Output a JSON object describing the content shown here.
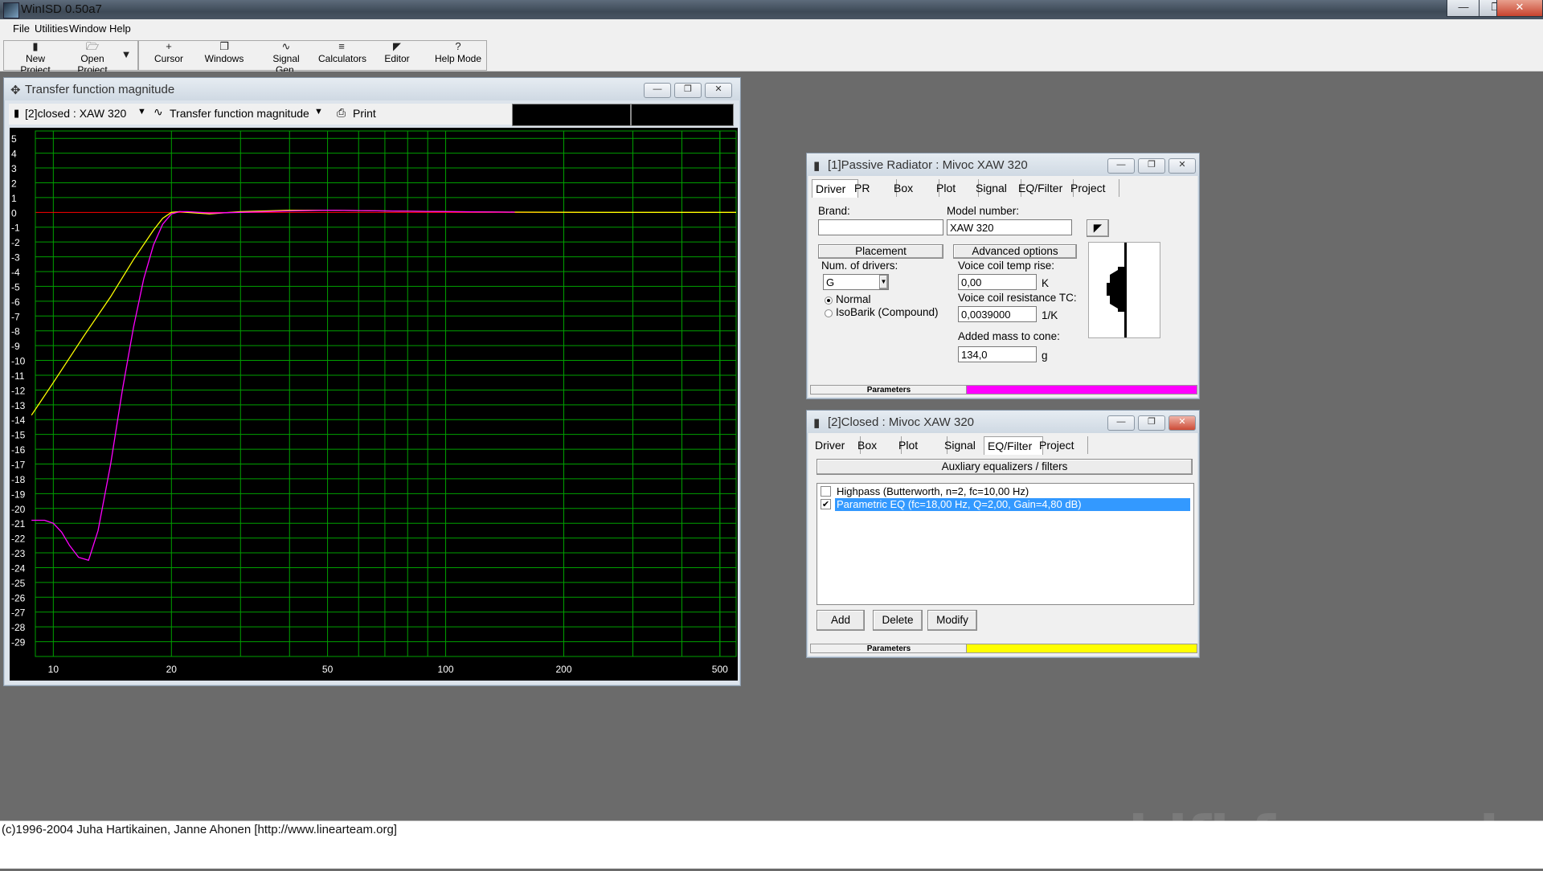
{
  "app": {
    "title": "WinISD 0.50a7",
    "colors": {
      "chart_bg": "#000000",
      "grid": "#00a000",
      "zero_line": "#ff0000",
      "pr_series": "#ffff00",
      "closed_series": "#ff00ff"
    }
  },
  "menu": {
    "file": "File",
    "utilities": "Utilities",
    "window": "Window",
    "help": "Help"
  },
  "toolbar": {
    "new_project": "New Project",
    "open_project": "Open Project",
    "cursor": "Cursor",
    "windows": "Windows",
    "signal_gen": "Signal Gen.",
    "calculators": "Calculators",
    "editor": "Editor",
    "help_mode": "Help Mode",
    "icons": {
      "new_project": "document-icon",
      "open_project": "folder-icon",
      "cursor": "crosshair-icon",
      "windows": "windows-icon",
      "signal_gen": "waveform-icon",
      "calculators": "calculator-icon",
      "editor": "speaker-icon",
      "help_mode": "question-icon"
    }
  },
  "chart_window": {
    "title": "Transfer function magnitude",
    "project_select": "[2]closed : XAW 320",
    "plot_select": "Transfer function magnitude",
    "print_label": "Print"
  },
  "chart_data": {
    "type": "line",
    "title": "",
    "xlabel": "",
    "ylabel": "",
    "x_scale": "log",
    "xlim": [
      9,
      550
    ],
    "ylim": [
      -30,
      5.5
    ],
    "x_ticks": [
      10,
      20,
      50,
      100,
      200,
      500
    ],
    "y_ticks": [
      5,
      4,
      3,
      2,
      1,
      0,
      -1,
      -2,
      -3,
      -4,
      -5,
      -6,
      -7,
      -8,
      -9,
      -10,
      -11,
      -12,
      -13,
      -14,
      -15,
      -16,
      -17,
      -18,
      -19,
      -20,
      -21,
      -22,
      -23,
      -24,
      -25,
      -26,
      -27,
      -28,
      -29
    ],
    "grid": true,
    "series": [
      {
        "color": "#ffff00",
        "x": [
          8.8,
          10,
          12,
          14,
          16,
          18,
          19,
          20,
          21,
          22,
          25,
          30,
          40,
          50,
          70,
          100,
          150,
          250,
          550
        ],
        "y": [
          -13.7,
          -11.5,
          -8.3,
          -5.7,
          -3.2,
          -1.2,
          -0.4,
          0.0,
          0.05,
          0.0,
          -0.1,
          0.05,
          0.15,
          0.15,
          0.1,
          0.05,
          0.02,
          0.0,
          0.0
        ]
      },
      {
        "color": "#ff00ff",
        "x": [
          8.8,
          9.5,
          10,
          10.5,
          11,
          11.6,
          12.3,
          13,
          14,
          15,
          16,
          17,
          18,
          19,
          20,
          21,
          22,
          25,
          30,
          40,
          50,
          70,
          100,
          150
        ],
        "y": [
          -20.8,
          -20.8,
          -21.0,
          -21.6,
          -22.5,
          -23.3,
          -23.5,
          -21.5,
          -17.0,
          -12.0,
          -7.8,
          -4.5,
          -2.2,
          -0.8,
          -0.1,
          0.05,
          0.05,
          -0.05,
          0.0,
          0.1,
          0.15,
          0.1,
          0.05,
          0.02
        ]
      }
    ]
  },
  "pr_window": {
    "title": "[1]Passive Radiator : Mivoc XAW 320",
    "tabs": [
      "Driver",
      "PR",
      "Box",
      "Plot",
      "Signal",
      "EQ/Filter",
      "Project"
    ],
    "brand_label": "Brand:",
    "brand_value": "",
    "model_label": "Model number:",
    "model_value": "XAW 320",
    "placement_label": "Placement",
    "advanced_label": "Advanced options",
    "num_drivers_label": "Num. of drivers:",
    "num_drivers_value": "G",
    "normal_label": "Normal",
    "isobarik_label": "IsoBarik (Compound)",
    "vc_temp_label": "Voice coil temp rise:",
    "vc_temp_value": "0,00",
    "vc_temp_unit": "K",
    "vc_res_label": "Voice coil resistance TC:",
    "vc_res_value": "0,0039000",
    "vc_res_unit": "1/K",
    "added_mass_label": "Added mass to cone:",
    "added_mass_value": "134,0",
    "added_mass_unit": "g",
    "status_label": "Parameters",
    "status_color": "#ff00ff"
  },
  "closed_window": {
    "title": "[2]Closed : Mivoc XAW 320",
    "tabs": [
      "Driver",
      "Box",
      "Plot",
      "Signal",
      "EQ/Filter",
      "Project"
    ],
    "section_label": "Auxliary equalizers / filters",
    "items": [
      {
        "label": "Highpass (Butterworth, n=2, fc=10,00 Hz)",
        "checked": false
      },
      {
        "label": "Parametric EQ (fc=18,00 Hz, Q=2,00, Gain=4,80 dB)",
        "checked": true
      }
    ],
    "add_label": "Add",
    "delete_label": "Delete",
    "modify_label": "Modify",
    "status_label": "Parameters",
    "status_color": "#ffff00"
  },
  "statusbar": {
    "copyright": "(c)1996-2004 Juha Hartikainen, Janne Ahonen [http://www.linearteam.org]"
  },
  "watermark": "hifi-forum.de"
}
